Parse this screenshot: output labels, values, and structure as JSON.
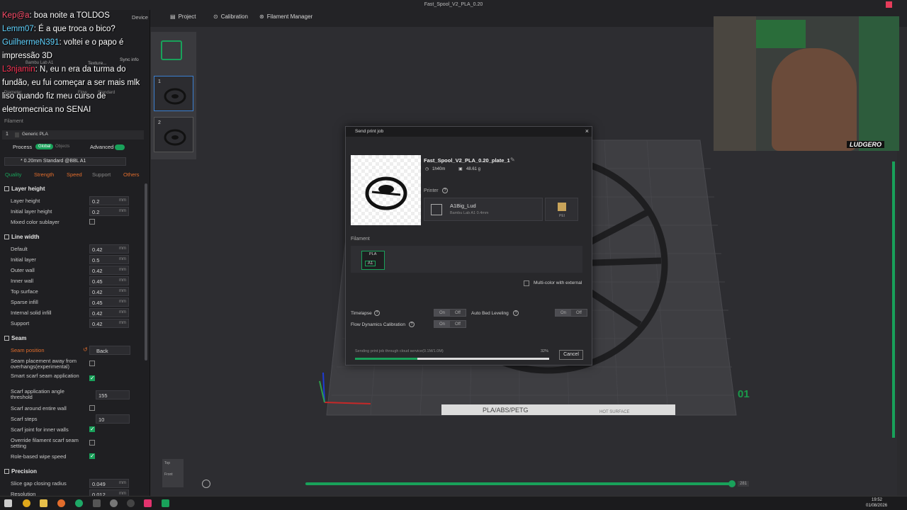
{
  "window_title": "Fast_Spool_V2_PLA_0.20",
  "topnav": {
    "project": "Project",
    "calibration": "Calibration",
    "filament_manager": "Filament Manager"
  },
  "chat": [
    {
      "user": "Kep@a",
      "user_color": "#ff4d6a",
      "text": ": boa noite a TOLDOS"
    },
    {
      "user": "Lemm07",
      "user_color": "#5fd3ff",
      "text": ": É a que troca o bico?"
    },
    {
      "user": "GuilhermeN391",
      "user_color": "#5fd3ff",
      "text": ": voltei e o papo é impressão 3D"
    },
    {
      "user": "L3njamin",
      "user_color": "#ff3355",
      "text": ": N, eu n era da turma do fundão, eu fui começar a ser mais mlk liso quando fiz meu curso de eletromecnica no SENAI"
    }
  ],
  "left": {
    "device_label": "Device",
    "printer_name": "Bambu Lab A1",
    "texture_label": "Texture...",
    "sync_label": "Sync info",
    "diameter_label": "Diameter",
    "flow_label": "Flow",
    "standard_label": "Standard",
    "filament_header": "Filament",
    "filament_index": "1",
    "filament_name": "Generic PLA",
    "process_label": "Process",
    "global_label": "Global",
    "objects_label": "Objects",
    "advanced_label": "Advanced",
    "preset": "* 0.20mm Standard @BBL A1",
    "tabs": [
      "Quality",
      "Strength",
      "Speed",
      "Support",
      "Others"
    ],
    "sections": {
      "layer_height": "Layer height",
      "line_width": "Line width",
      "seam": "Seam",
      "precision": "Precision"
    },
    "layer_rows": [
      {
        "label": "Layer height",
        "value": "0.2",
        "unit": "mm"
      },
      {
        "label": "Initial layer height",
        "value": "0.2",
        "unit": "mm"
      }
    ],
    "mixed_color": "Mixed color sublayer",
    "line_rows": [
      {
        "label": "Default",
        "value": "0.42",
        "unit": "mm"
      },
      {
        "label": "Initial layer",
        "value": "0.5",
        "unit": "mm"
      },
      {
        "label": "Outer wall",
        "value": "0.42",
        "unit": "mm"
      },
      {
        "label": "Inner wall",
        "value": "0.45",
        "unit": "mm"
      },
      {
        "label": "Top surface",
        "value": "0.42",
        "unit": "mm"
      },
      {
        "label": "Sparse infill",
        "value": "0.45",
        "unit": "mm"
      },
      {
        "label": "Internal solid infill",
        "value": "0.42",
        "unit": "mm"
      },
      {
        "label": "Support",
        "value": "0.42",
        "unit": "mm"
      }
    ],
    "seam_position_label": "Seam position",
    "seam_position_value": "Back",
    "seam_rows": [
      {
        "label": "Seam placement away from overhangs(experimental)",
        "checked": false
      },
      {
        "label": "Smart scarf seam application",
        "checked": true
      }
    ],
    "scarf_angle_label": "Scarf application angle threshold",
    "scarf_angle_value": "155",
    "scarf_around_label": "Scarf around entire wall",
    "scarf_steps_label": "Scarf steps",
    "scarf_steps_value": "10",
    "scarf_inner_label": "Scarf joint for inner walls",
    "override_label": "Override filament scarf seam setting",
    "role_wipe_label": "Role-based wipe speed",
    "precision_rows": [
      {
        "label": "Slice gap closing radius",
        "value": "0.049",
        "unit": "mm"
      },
      {
        "label": "Resolution",
        "value": "0.012",
        "unit": "mm"
      }
    ]
  },
  "plates": [
    "1",
    "2"
  ],
  "dialog": {
    "title": "Send print job",
    "file_name": "Fast_Spool_V2_PLA_0.20_plate_1",
    "time": "1h40m",
    "weight": "48.61 g",
    "printer_label": "Printer",
    "printer_name": "A1Big_Lud",
    "printer_model": "Bambu Lab A1 0.4mm",
    "plate_type": "PEI",
    "filament_label": "Filament",
    "filament_type": "PLA",
    "filament_slot": "A1",
    "multicolor_label": "Multi-color with external",
    "timelapse_label": "Timelapse",
    "bed_leveling_label": "Auto Bed Leveling",
    "flow_cal_label": "Flow Dynamics Calibration",
    "on": "On",
    "off": "Off",
    "status": "Sending print job through cloud service(0.1M/1.0M)",
    "progress_pct": "32%",
    "progress": 0.32,
    "cancel": "Cancel"
  },
  "viewport": {
    "bed_label": "PLA/ABS/PETG",
    "bed_right_label": "HOT SURFACE",
    "plate_number": "01",
    "view_top": "Top",
    "view_front": "Front",
    "slider_value": "281"
  },
  "taskbar": {
    "time": "19:52",
    "date": "01/08/2026"
  },
  "webcam": {
    "overlay_text": "LUDGERO"
  }
}
